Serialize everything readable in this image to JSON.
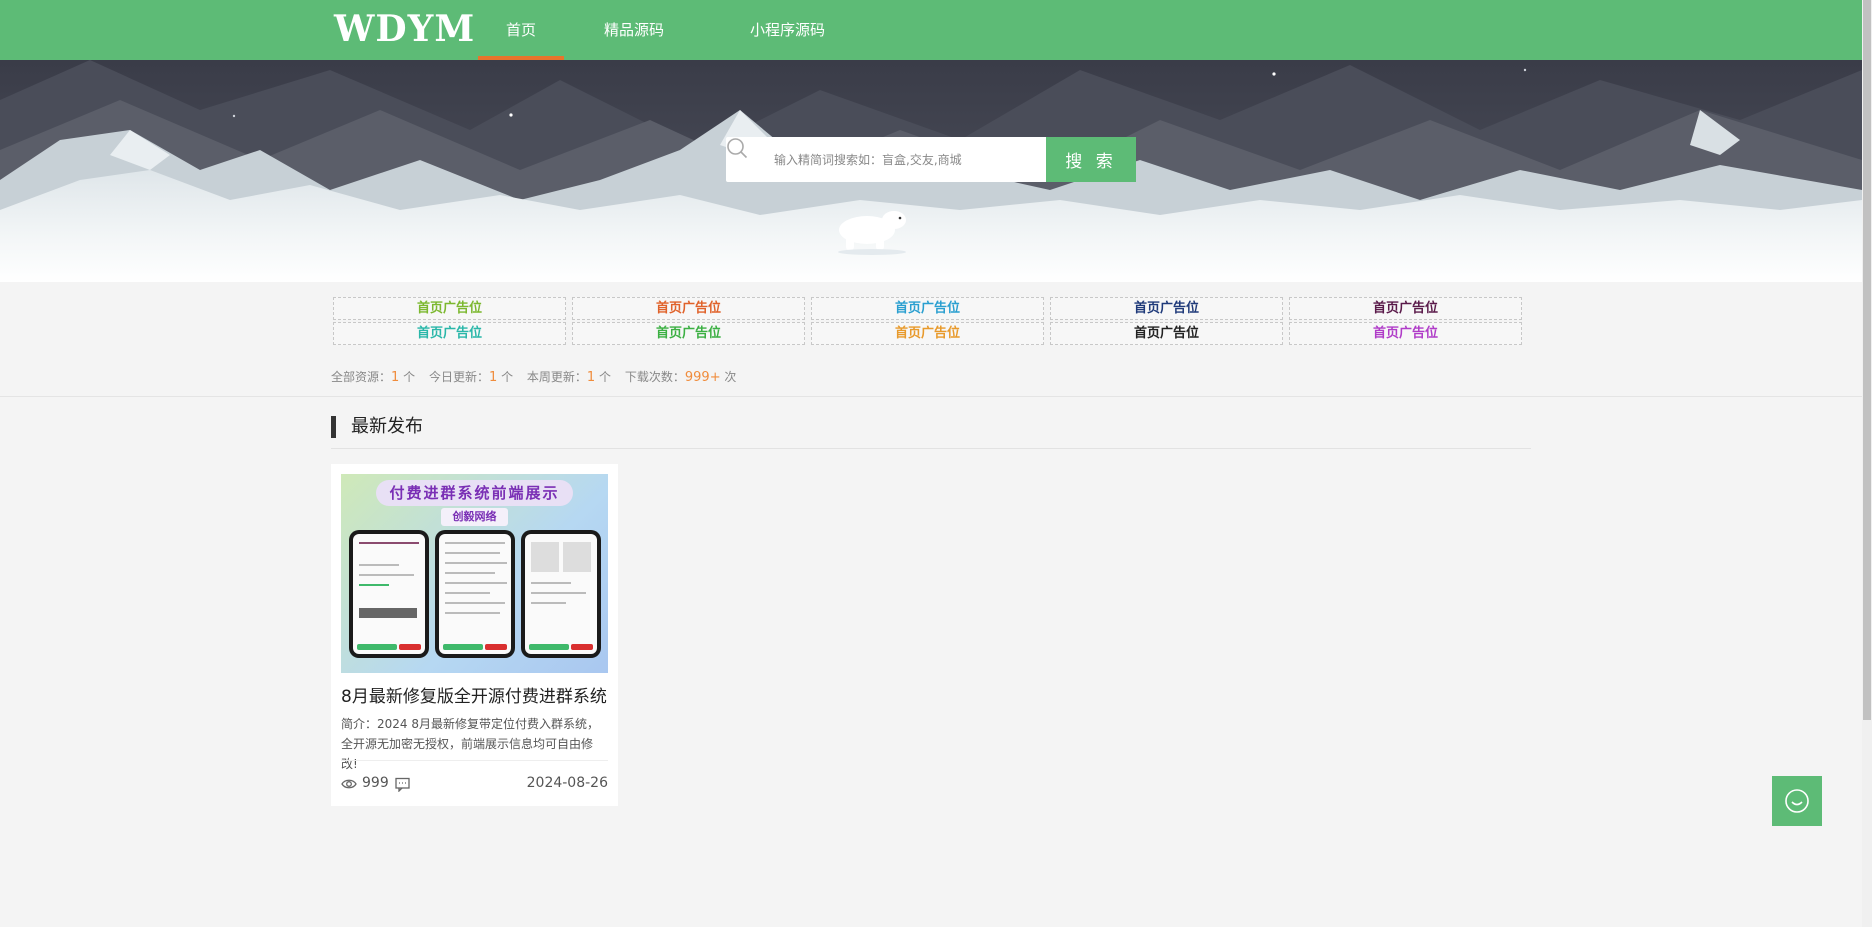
{
  "header": {
    "logo": "WDYM",
    "nav": [
      {
        "label": "首页",
        "active": true
      },
      {
        "label": "精品源码",
        "active": false
      },
      {
        "label": "小程序源码",
        "active": false
      }
    ]
  },
  "search": {
    "placeholder": "输入精简词搜索如：盲盒,交友,商城",
    "button_label": "搜 索"
  },
  "ads": [
    {
      "label": "首页广告位",
      "color": "#7cb82f"
    },
    {
      "label": "首页广告位",
      "color": "#e0622a"
    },
    {
      "label": "首页广告位",
      "color": "#2a9fd0"
    },
    {
      "label": "首页广告位",
      "color": "#1f3a7a"
    },
    {
      "label": "首页广告位",
      "color": "#5a1a4a"
    },
    {
      "label": "首页广告位",
      "color": "#2ab7a9"
    },
    {
      "label": "首页广告位",
      "color": "#3cb043"
    },
    {
      "label": "首页广告位",
      "color": "#e89a2c"
    },
    {
      "label": "首页广告位",
      "color": "#222222"
    },
    {
      "label": "首页广告位",
      "color": "#b03cc8"
    }
  ],
  "stats": {
    "total_label": "全部资源：",
    "total_value": "1",
    "total_unit": " 个",
    "today_label": "今日更新：",
    "today_value": "1",
    "today_unit": " 个",
    "week_label": "本周更新：",
    "week_value": "1",
    "week_unit": " 个",
    "downloads_label": "下载次数：",
    "downloads_value": "999+",
    "downloads_unit": " 次"
  },
  "section": {
    "title": "最新发布"
  },
  "cards": [
    {
      "thumb_title": "付费进群系统前端展示",
      "thumb_subtitle": "创毅网络",
      "title": "8月最新修复版全开源付费进群系统",
      "desc": "简介：2024 8月最新修复带定位付费入群系统，全开源无加密无授权，前端展示信息均可自由修改!",
      "views": "999",
      "date": "2024-08-26"
    }
  ],
  "colors": {
    "brand": "#5dbb76",
    "nav_active_underline": "#e8742c",
    "stat_number": "#f08c3c"
  },
  "icons": [
    "search-icon",
    "eye-icon",
    "comment-icon",
    "chat-icon"
  ]
}
